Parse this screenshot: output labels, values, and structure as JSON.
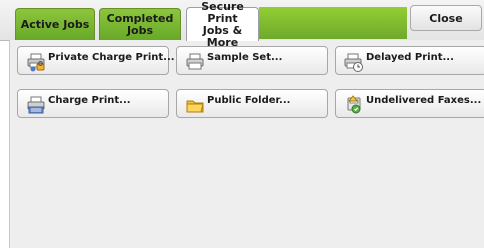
{
  "tabs": [
    {
      "label": "Active Jobs"
    },
    {
      "label": "Completed\nJobs"
    },
    {
      "label": "Secure Print\nJobs & More"
    }
  ],
  "close_label": "Close",
  "buttons": [
    {
      "label": "Private Charge Print...",
      "icon": "lock-printer-icon"
    },
    {
      "label": "Sample Set...",
      "icon": "printer-icon"
    },
    {
      "label": "Delayed Print...",
      "icon": "clock-printer-icon"
    },
    {
      "label": "Charge Print...",
      "icon": "calculator-printer-icon"
    },
    {
      "label": "Public Folder...",
      "icon": "folder-icon"
    },
    {
      "label": "Undelivered Faxes...",
      "icon": "fax-warning-icon"
    }
  ],
  "colors": {
    "tab_green": "#7ab533",
    "active_tab": "#ffffff",
    "panel": "#eeeeee"
  }
}
